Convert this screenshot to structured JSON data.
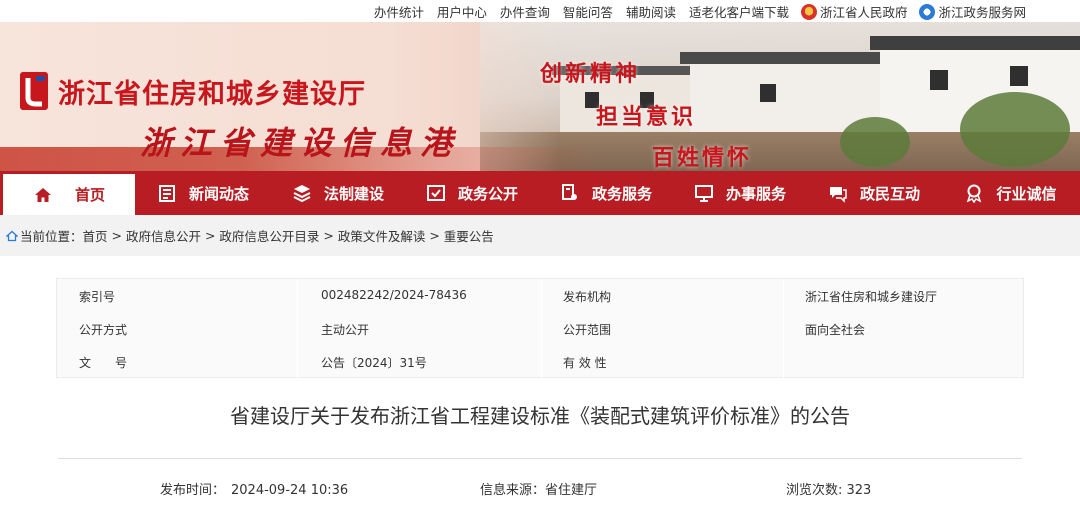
{
  "topbar": {
    "links": [
      "办件统计",
      "用户中心",
      "办件查询",
      "智能问答",
      "辅助阅读",
      "适老化客户端下载"
    ],
    "gov_links": [
      "浙江省人民政府",
      "浙江政务服务网"
    ]
  },
  "banner": {
    "org_name": "浙江省住房和城乡建设厅",
    "site_name": "浙江省建设信息港",
    "slogans": [
      "创新精神",
      "担当意识",
      "百姓情怀"
    ],
    "brand_color": "#c8161d"
  },
  "nav": {
    "accent_color": "#b71d22",
    "items": [
      {
        "label": "首页",
        "icon": "home-icon",
        "active": true
      },
      {
        "label": "新闻动态",
        "icon": "news-icon",
        "active": false
      },
      {
        "label": "法制建设",
        "icon": "layers-icon",
        "active": false
      },
      {
        "label": "政务公开",
        "icon": "document-check-icon",
        "active": false
      },
      {
        "label": "政务服务",
        "icon": "service-key-icon",
        "active": false
      },
      {
        "label": "办事服务",
        "icon": "monitor-icon",
        "active": false
      },
      {
        "label": "政民互动",
        "icon": "chat-icon",
        "active": false
      },
      {
        "label": "行业诚信",
        "icon": "badge-icon",
        "active": false
      }
    ]
  },
  "breadcrumb": {
    "prefix": "当前位置：",
    "items": [
      "首页",
      "政府信息公开",
      "政府信息公开目录",
      "政策文件及解读",
      "重要公告"
    ],
    "separator": " > "
  },
  "meta": {
    "rows": [
      {
        "label1": "索引号",
        "value1": "002482242/2024-78436",
        "label2": "发布机构",
        "value2": "浙江省住房和城乡建设厅"
      },
      {
        "label1": "公开方式",
        "value1": "主动公开",
        "label2": "公开范围",
        "value2": "面向全社会"
      },
      {
        "label1": "文　　号",
        "value1": "公告〔2024〕31号",
        "label2": "有 效 性",
        "value2": ""
      }
    ]
  },
  "article": {
    "title": "省建设厅关于发布浙江省工程建设标准《装配式建筑评价标准》的公告",
    "publish_label": "发布时间：",
    "publish_time": "2024-09-24 10:36",
    "source_label": "信息来源：",
    "source": "省住建厅",
    "views_label": "浏览次数: ",
    "views": "323"
  }
}
